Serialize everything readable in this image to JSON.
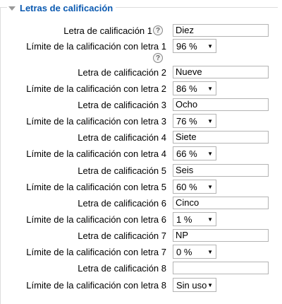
{
  "section": {
    "title": "Letras de calificación"
  },
  "rows": [
    {
      "letter_label": "Letra de calificación 1",
      "letter_value": "Diez",
      "limit_label": "Límite de la calificación con letra 1",
      "limit_value": "96 %"
    },
    {
      "letter_label": "Letra de calificación 2",
      "letter_value": "Nueve",
      "limit_label": "Límite de la calificación con letra 2",
      "limit_value": "86 %"
    },
    {
      "letter_label": "Letra de calificación 3",
      "letter_value": "Ocho",
      "limit_label": "Límite de la calificación con letra 3",
      "limit_value": "76 %"
    },
    {
      "letter_label": "Letra de calificación 4",
      "letter_value": "Siete",
      "limit_label": "Límite de la calificación con letra 4",
      "limit_value": "66 %"
    },
    {
      "letter_label": "Letra de calificación 5",
      "letter_value": "Seis",
      "limit_label": "Límite de la calificación con letra 5",
      "limit_value": "60 %"
    },
    {
      "letter_label": "Letra de calificación 6",
      "letter_value": "Cinco",
      "limit_label": "Límite de la calificación con letra 6",
      "limit_value": "1 %"
    },
    {
      "letter_label": "Letra de calificación 7",
      "letter_value": "NP",
      "limit_label": "Límite de la calificación con letra 7",
      "limit_value": "0 %"
    },
    {
      "letter_label": "Letra de calificación 8",
      "letter_value": "",
      "limit_label": "Límite de la calificación con letra 8",
      "limit_value": "Sin uso"
    }
  ],
  "help_icon": {
    "name": "help-icon",
    "glyph": "?"
  },
  "colors": {
    "accent": "#0a59b0",
    "border": "#b4b4b4"
  }
}
